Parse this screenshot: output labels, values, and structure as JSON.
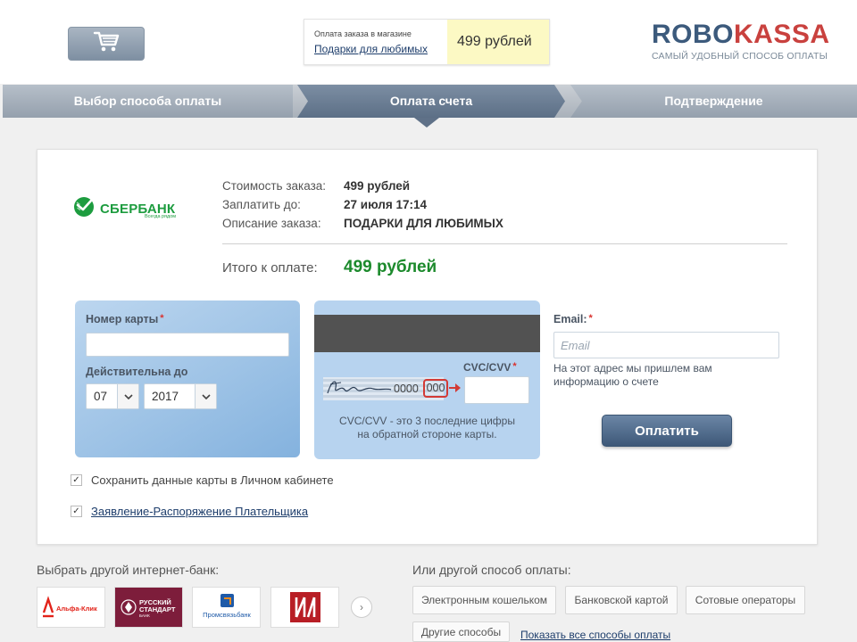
{
  "header": {
    "cart_icon": "cart-icon",
    "order_caption": "Оплата заказа в магазине",
    "order_shop_link": "Подарки для любимых",
    "order_price": "499 рублей",
    "logo_part1": "ROBO",
    "logo_part2": "KASSA",
    "logo_slogan": "САМЫЙ УДОБНЫЙ СПОСОБ ОПЛАТЫ"
  },
  "steps": [
    "Выбор способа оплаты",
    "Оплата счета",
    "Подтверждение"
  ],
  "bank": {
    "name": "СБЕРБАНК",
    "tagline": "Всегда рядом"
  },
  "order_info": [
    {
      "label": "Стоимость заказа:",
      "value": "499 рублей"
    },
    {
      "label": "Заплатить до:",
      "value": "27 июля 17:14"
    },
    {
      "label": "Описание заказа:",
      "value": "ПОДАРКИ ДЛЯ ЛЮБИМЫХ"
    }
  ],
  "total": {
    "label": "Итого к оплате:",
    "value": "499 рублей"
  },
  "card": {
    "number_label": "Номер карты",
    "expiry_label": "Действительна до",
    "month": "07",
    "year": "2017",
    "required_mark": "*",
    "cvc_label": "CVC/CVV",
    "sig_numbers": "0000",
    "cvc_sample": "000",
    "cvc_hint_line1": "CVC/CVV - это 3 последние цифры",
    "cvc_hint_line2": "на обратной стороне карты."
  },
  "email": {
    "label": "Email:",
    "placeholder": "Email",
    "note": "На этот адрес мы пришлем вам информацию о счете"
  },
  "pay_button": "Оплатить",
  "checkboxes": [
    {
      "label": "Сохранить данные карты в Личном кабинете",
      "checked": true,
      "link": false
    },
    {
      "label": "Заявление-Распоряжение Плательщика",
      "checked": true,
      "link": true
    }
  ],
  "check_mark": "✓",
  "other_banks": {
    "heading": "Выбрать другой интернет-банк:",
    "alfa_label": "Альфа-Клик",
    "rs_line1": "РУССКИЙ",
    "rs_line2": "СТАНДАРТ",
    "rs_line3": "БАНК",
    "psb_label": "Промсвязьбанк",
    "next_symbol": "›"
  },
  "other_methods": {
    "heading": "Или другой способ оплаты:",
    "buttons": [
      "Электронным кошельком",
      "Банковской картой",
      "Сотовые операторы",
      "Другие способы"
    ],
    "show_all": "Показать все способы оплаты"
  },
  "colors": {
    "accent_blue": "#3e5878",
    "sber_green": "#1d9c3f",
    "logo_red": "#c9413e",
    "total_green": "#1c8a2c"
  }
}
